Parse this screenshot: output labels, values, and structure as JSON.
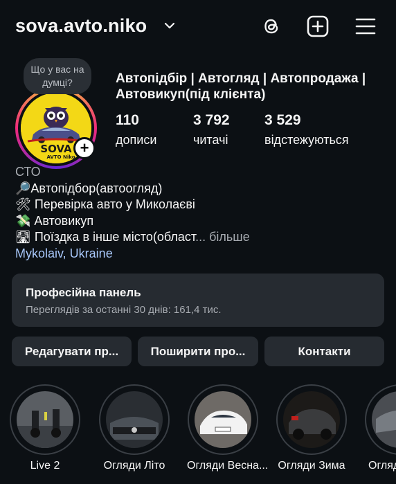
{
  "header": {
    "username": "sova.avto.niko",
    "icons": [
      "chevron-down-icon",
      "threads-icon",
      "new-post-icon",
      "menu-icon"
    ]
  },
  "profile": {
    "note_bubble": "Що у вас на думці?",
    "display_name": "Автопідбір | Автогляд | Автопродажа | Автовикуп(під клієнта)",
    "avatar_text": "SOVA",
    "avatar_subtext": "AVTO Niko",
    "stats": [
      {
        "value": "110",
        "label": "дописи"
      },
      {
        "value": "3 792",
        "label": "читачі"
      },
      {
        "value": "3 529",
        "label": "відстежуються"
      }
    ],
    "category": "СТО",
    "bio_lines": [
      "🔎Автопідбор(автоогляд)",
      "🛠 Перевірка авто у Миколаєві",
      "💸 Автовикуп",
      "🛣 Поїздка в інше місто(област"
    ],
    "more": "... більше",
    "location": "Mykolaiv, Ukraine"
  },
  "pro_panel": {
    "title": "Професійна панель",
    "subtitle": "Переглядів за останні 30 днів: 161,4 тис."
  },
  "buttons": {
    "edit": "Редагувати пр...",
    "share": "Поширити про...",
    "contacts": "Контакти"
  },
  "highlights": [
    {
      "label": "Live 2"
    },
    {
      "label": "Огляди Літо"
    },
    {
      "label": "Огляди Весна..."
    },
    {
      "label": "Огляди Зима"
    },
    {
      "label": "Огляд..."
    }
  ],
  "colors": {
    "background": "#0c1014",
    "surface": "#262b31",
    "link": "#a8c7fa",
    "muted": "#a8acb2",
    "avatar_yellow": "#f3d816"
  }
}
